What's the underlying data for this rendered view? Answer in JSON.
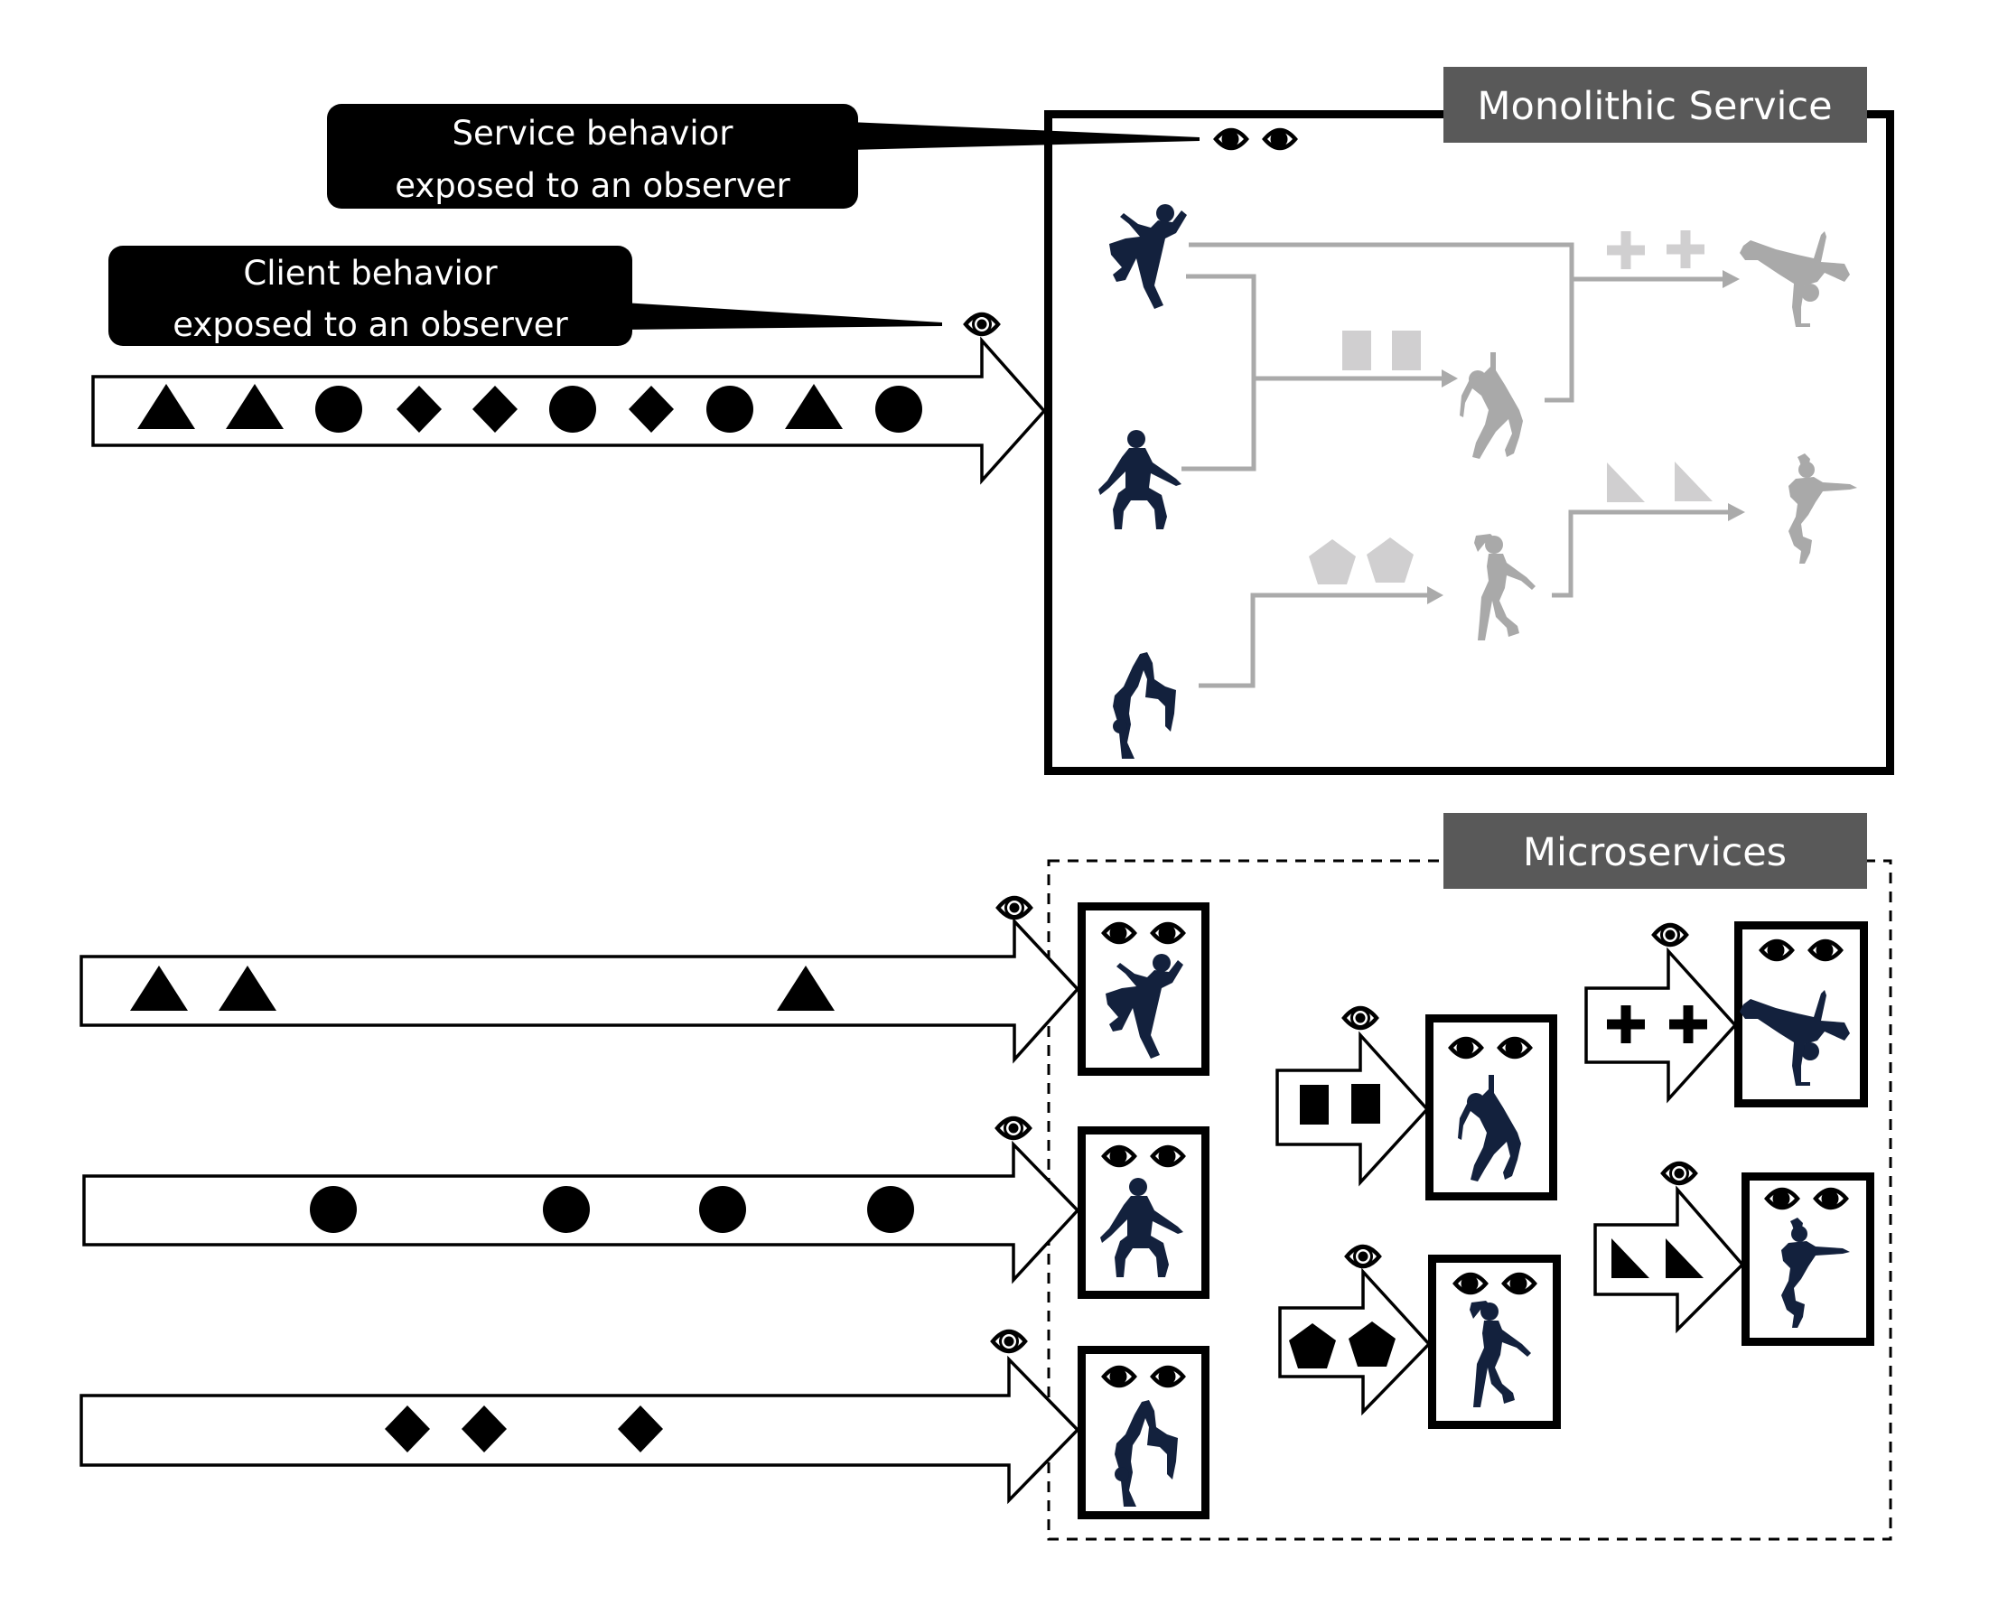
{
  "colors": {
    "ink": "#000000",
    "label_bg": "#595959",
    "label_text": "#ffffff",
    "dancer_active": "#13213d",
    "dancer_inactive": "#a9a9a9",
    "flow_line": "#aaaaaa",
    "message_inactive": "#d0cfd0",
    "background": "#ffffff"
  },
  "callouts": {
    "service": {
      "line1": "Service behavior",
      "line2": "exposed to an observer",
      "points_to": "service-eyes-icon"
    },
    "client": {
      "line1": "Client behavior",
      "line2": "exposed to an observer",
      "points_to": "client-eye-icon"
    }
  },
  "monolithic": {
    "label": "Monolithic Service",
    "client_stream": [
      "triangle",
      "triangle",
      "circle",
      "diamond",
      "diamond",
      "circle",
      "diamond",
      "circle",
      "triangle",
      "circle"
    ],
    "entry_dancers": [
      "kick-dancer",
      "crouch-dancer",
      "backbend-dancer"
    ],
    "internal_flows": [
      {
        "from": [
          "kick-dancer",
          "crouch-dancer"
        ],
        "message": "square",
        "count": 2,
        "to": "falling-dancer"
      },
      {
        "from": [
          "kick-dancer",
          "falling-dancer"
        ],
        "message": "plus",
        "count": 2,
        "to": "breakdance-dancer"
      },
      {
        "from": [
          "backbend-dancer"
        ],
        "message": "pentagon",
        "count": 2,
        "to": "ponytail-dancer"
      },
      {
        "from": [
          "ponytail-dancer"
        ],
        "message": "right-triangle",
        "count": 2,
        "to": "leaping-dancer"
      }
    ]
  },
  "microservices": {
    "label": "Microservices",
    "client_streams": [
      {
        "shapes": [
          "triangle",
          "triangle",
          "triangle"
        ],
        "target": "kick-dancer"
      },
      {
        "shapes": [
          "circle",
          "circle",
          "circle",
          "circle"
        ],
        "target": "crouch-dancer"
      },
      {
        "shapes": [
          "diamond",
          "diamond",
          "diamond"
        ],
        "target": "backbend-dancer"
      }
    ],
    "services": [
      {
        "dancer": "kick-dancer",
        "observed": true
      },
      {
        "dancer": "crouch-dancer",
        "observed": true
      },
      {
        "dancer": "backbend-dancer",
        "observed": true
      },
      {
        "dancer": "falling-dancer",
        "observed": true,
        "incoming": {
          "message": "square",
          "count": 2
        }
      },
      {
        "dancer": "ponytail-dancer",
        "observed": true,
        "incoming": {
          "message": "pentagon",
          "count": 2
        }
      },
      {
        "dancer": "breakdance-dancer",
        "observed": true,
        "incoming": {
          "message": "plus",
          "count": 2
        }
      },
      {
        "dancer": "leaping-dancer",
        "observed": true,
        "incoming": {
          "message": "right-triangle",
          "count": 2
        }
      }
    ]
  }
}
